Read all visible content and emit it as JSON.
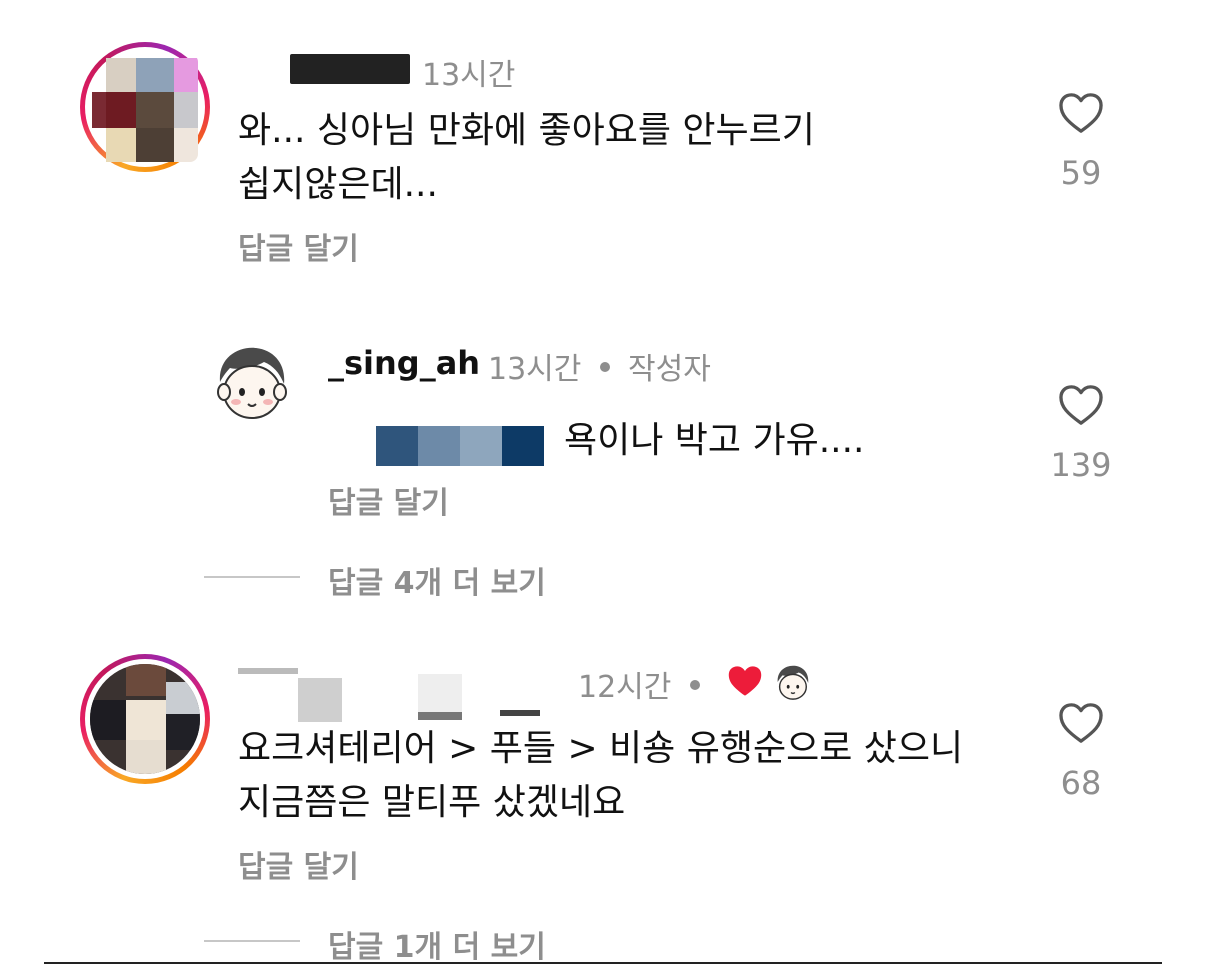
{
  "comments": [
    {
      "time": "13시간",
      "text_line1": "와... 싱아님 만화에 좋아요를 안누르기",
      "text_line2": "쉽지않은데...",
      "reply_label": "답글 달기",
      "likes": "59"
    },
    {
      "username": "_sing_ah",
      "time": "13시간",
      "badge": "작성자",
      "text": "욕이나 박고 가유....",
      "reply_label": "답글 달기",
      "likes": "139"
    },
    {
      "time": "12시간",
      "text_line1": "요크셔테리어 > 푸들 > 비숑 유행순으로 샀으니",
      "text_line2": "지금쯤은 말티푸 샀겠네요",
      "reply_label": "답글 달기",
      "likes": "68"
    }
  ],
  "view_more": [
    {
      "label": "답글 4개 더 보기"
    },
    {
      "label": "답글 1개 더 보기"
    }
  ],
  "colors": {
    "heart_red": "#ed4956",
    "muted_text": "#8e8e8e"
  }
}
